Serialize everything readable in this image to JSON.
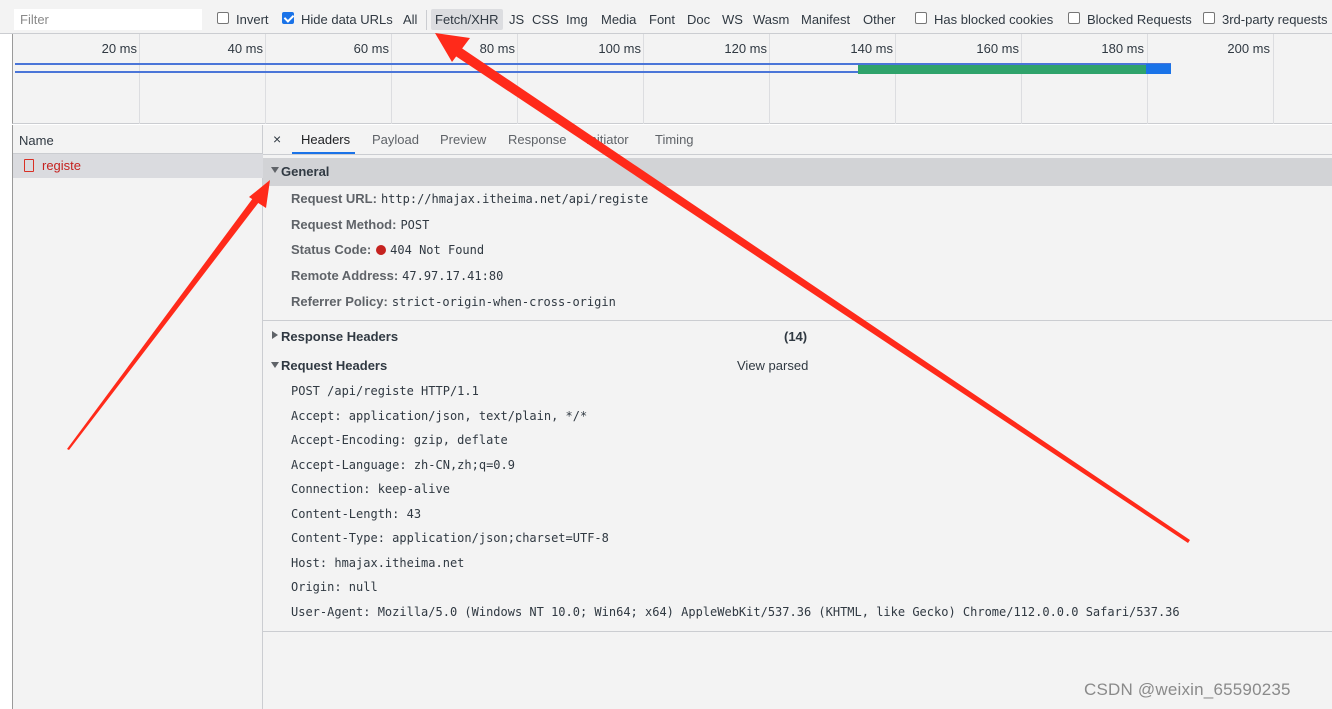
{
  "toolbar": {
    "filter_placeholder": "Filter",
    "invert_label": "Invert",
    "hide_data_urls_label": "Hide data URLs",
    "types": [
      "All",
      "Fetch/XHR",
      "JS",
      "CSS",
      "Img",
      "Media",
      "Font",
      "Doc",
      "WS",
      "Wasm",
      "Manifest",
      "Other"
    ],
    "active_type": "Fetch/XHR",
    "has_blocked_cookies_label": "Has blocked cookies",
    "blocked_requests_label": "Blocked Requests",
    "third_party_label": "3rd-party requests",
    "invert_checked": false,
    "hide_data_urls_checked": true,
    "has_blocked_cookies_checked": false,
    "blocked_requests_checked": false,
    "third_party_checked": false
  },
  "overview": {
    "ticks": [
      "20 ms",
      "40 ms",
      "60 ms",
      "80 ms",
      "100 ms",
      "120 ms",
      "140 ms",
      "160 ms",
      "180 ms",
      "200 ms"
    ]
  },
  "requests": {
    "header": "Name",
    "items": [
      {
        "name": "registe",
        "status": "failed"
      }
    ]
  },
  "details": {
    "tabs": [
      "Headers",
      "Payload",
      "Preview",
      "Response",
      "Initiator",
      "Timing"
    ],
    "active_tab": "Headers",
    "general": {
      "title": "General",
      "rows": [
        {
          "key": "Request URL:",
          "value": "http://hmajax.itheima.net/api/registe"
        },
        {
          "key": "Request Method:",
          "value": "POST"
        },
        {
          "key": "Status Code:",
          "value": "404 Not Found"
        },
        {
          "key": "Remote Address:",
          "value": "47.97.17.41:80"
        },
        {
          "key": "Referrer Policy:",
          "value": "strict-origin-when-cross-origin"
        }
      ]
    },
    "response_headers": {
      "title": "Response Headers",
      "count": "(14)"
    },
    "request_headers": {
      "title": "Request Headers",
      "view_link": "View parsed",
      "lines": [
        "POST /api/registe HTTP/1.1",
        "Accept: application/json, text/plain, */*",
        "Accept-Encoding: gzip, deflate",
        "Accept-Language: zh-CN,zh;q=0.9",
        "Connection: keep-alive",
        "Content-Length: 43",
        "Content-Type: application/json;charset=UTF-8",
        "Host: hmajax.itheima.net",
        "Origin: null",
        "User-Agent: Mozilla/5.0 (Windows NT 10.0; Win64; x64) AppleWebKit/537.36 (KHTML, like Gecko) Chrome/112.0.0.0 Safari/537.36"
      ]
    }
  },
  "watermark": "CSDN @weixin_65590235",
  "colors": {
    "accent": "#1a73e8",
    "error": "#c5221f",
    "annotation_arrow": "#ff2a1a"
  }
}
